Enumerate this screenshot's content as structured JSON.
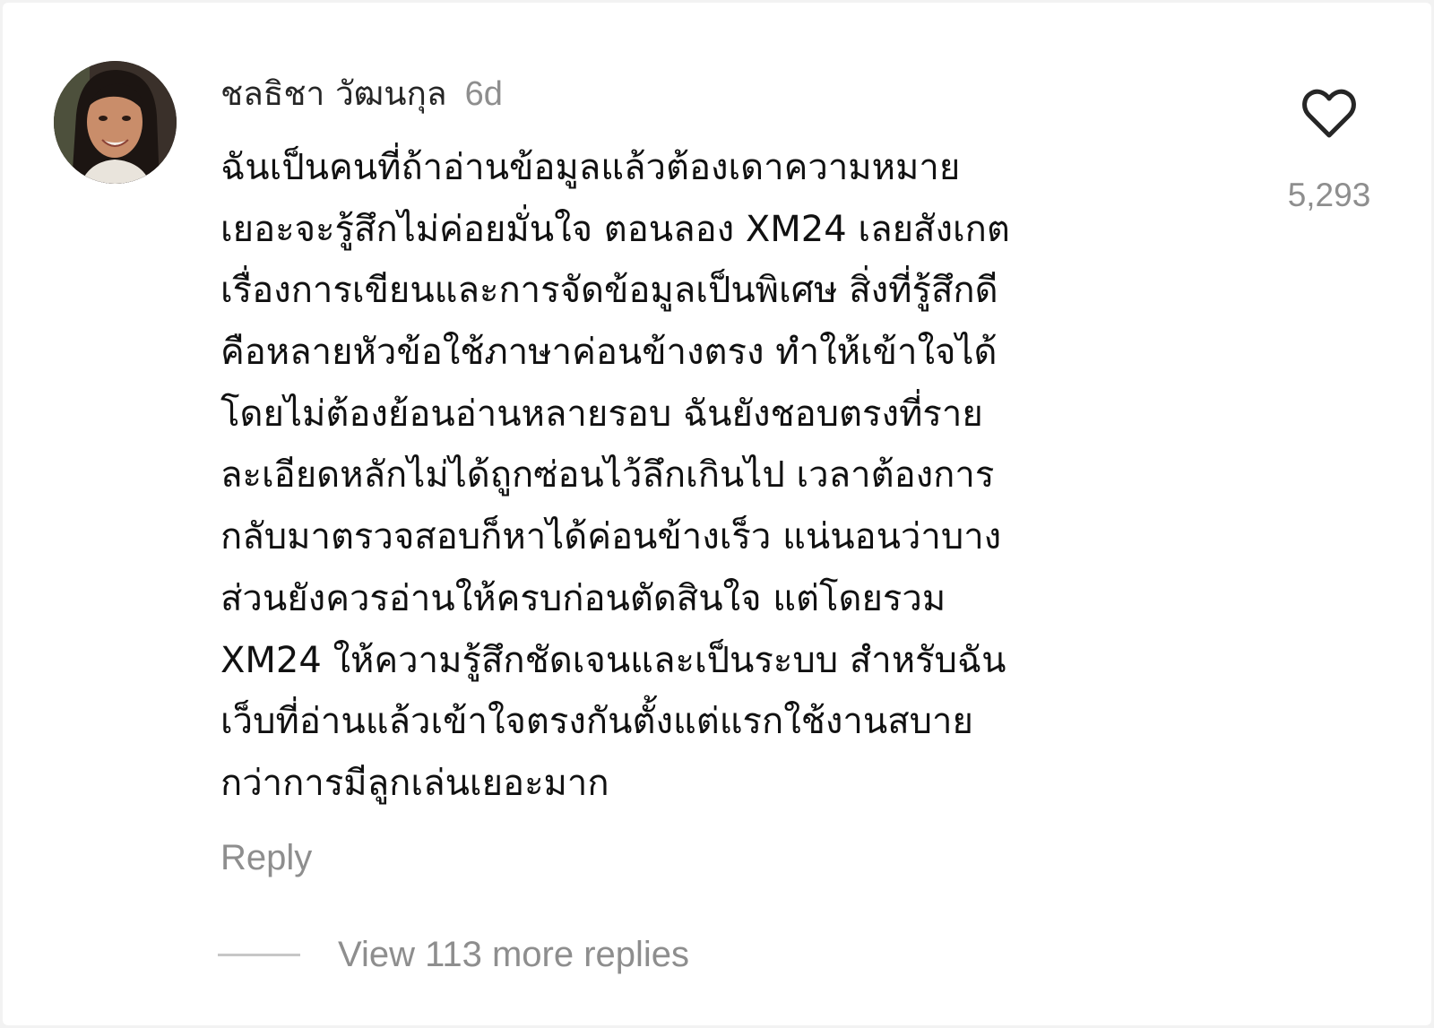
{
  "comment": {
    "author": "ชลธิชา วัฒนกุล",
    "timestamp": "6d",
    "body_lines": [
      "ฉันเป็นคนที่ถ้าอ่านข้อมูลแล้วต้องเดาความหมาย",
      "เยอะจะรู้สึกไม่ค่อยมั่นใจ ตอนลอง XM24 เลยสังเกต",
      "เรื่องการเขียนและการจัดข้อมูลเป็นพิเศษ สิ่งที่รู้สึกดี",
      "คือหลายหัวข้อใช้ภาษาค่อนข้างตรง ทำให้เข้าใจได้",
      "โดยไม่ต้องย้อนอ่านหลายรอบ ฉันยังชอบตรงที่ราย",
      "ละเอียดหลักไม่ได้ถูกซ่อนไว้ลึกเกินไป เวลาต้องการ",
      "กลับมาตรวจสอบก็หาได้ค่อนข้างเร็ว แน่นอนว่าบาง",
      "ส่วนยังควรอ่านให้ครบก่อนตัดสินใจ แต่โดยรวม",
      "XM24 ให้ความรู้สึกชัดเจนและเป็นระบบ สำหรับฉัน",
      "เว็บที่อ่านแล้วเข้าใจตรงกันตั้งแต่แรกใช้งานสบาย",
      "กว่าการมีลูกเล่นเยอะมาก"
    ],
    "like_icon": "heart-outline-icon",
    "like_count": "5,293",
    "reply_label": "Reply",
    "view_replies_label": "View 113 more replies"
  },
  "colors": {
    "text": "#111111",
    "muted": "#8e8e8e",
    "background": "#ffffff"
  }
}
